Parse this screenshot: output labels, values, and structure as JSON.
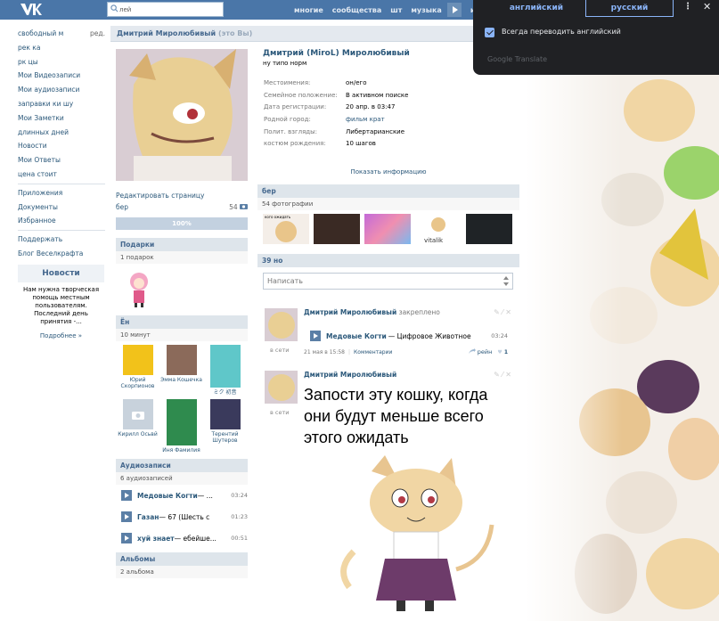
{
  "topbar": {
    "search_value": "лей",
    "nav": [
      "многие",
      "сообщества",
      "шт",
      "музыка",
      "и"
    ]
  },
  "leftmenu": {
    "edit_label": "ред.",
    "items": [
      "свободный м",
      "рек ка",
      "рк цы",
      "Мои Видеозаписи",
      "Мои аудиозаписи",
      "заправки ки шу",
      "Мои Заметки",
      "длинных дней",
      "Новости",
      "Мои Ответы",
      "цена стоит"
    ],
    "items2": [
      "Приложения",
      "Документы",
      "Избранное"
    ],
    "items3": [
      "Поддержать",
      "Блог Веселкрафта"
    ],
    "news_title": "Новости",
    "news_text": "Нам нужна творческая помощь местным пользователям. Последний день принятия -...",
    "news_more": "Подробнее »"
  },
  "profile": {
    "header_name": "Дмитрий Миролюбивый",
    "header_sub": "(это Вы)",
    "edit_page": "Редактировать страницу",
    "stat_label": "бер",
    "stat_num": "54",
    "progress_label": "100%",
    "progress_fraction": 1.0,
    "full_name": "Дмитрий (MiroL) Миролюбивый",
    "status": "ну типо норм",
    "info": [
      {
        "k": "Местоимения:",
        "v": "он/его",
        "link": false
      },
      {
        "k": "Семейное положение:",
        "v": "В активном поиске",
        "link": false
      },
      {
        "k": "Дата регистрации:",
        "v": "20 апр. в 03:47",
        "link": false
      },
      {
        "k": "Родной город:",
        "v": "фильм крат",
        "link": true
      },
      {
        "k": "Полит. взгляды:",
        "v": "Либертарианские",
        "link": false
      },
      {
        "k": "костюм рождения:",
        "v": "10 шагов",
        "link": false
      }
    ],
    "show_info": "Показать информацию"
  },
  "gifts": {
    "title": "Подарки",
    "count": "1 подарок"
  },
  "friends": {
    "title": "Ён",
    "sub": "10 минут",
    "list": [
      {
        "name": "Юрий Скорпионов",
        "color": "#f2c21a"
      },
      {
        "name": "Эмма Кошечка",
        "color": "#8b6a5a"
      },
      {
        "name": "ミク 初音",
        "color": "#5fc7c9"
      },
      {
        "name": "Кирилл Осьвй",
        "color": "#c8d2dc"
      },
      {
        "name": "Иня Фамилия",
        "color": "#2f8b4e"
      },
      {
        "name": "Терентий Шутеров",
        "color": "#3a3a5c"
      }
    ]
  },
  "audios": {
    "title": "Аудиозаписи",
    "count": "6 аудиозаписей",
    "list": [
      {
        "artist": "Медовые Когти",
        "title": " — ...",
        "dur": "03:24"
      },
      {
        "artist": "Газан",
        "title": " — 67 (Шесть с...",
        "dur": "01:23"
      },
      {
        "artist": "хуй знает",
        "title": " — ебейше...",
        "dur": "00:51"
      }
    ]
  },
  "albums": {
    "title": "Альбомы",
    "count": "2 альбома"
  },
  "photos": {
    "title": "бер",
    "count": "54 фотографии",
    "thumb1_text": "кого ожидать",
    "thumb4_text": "vitalik"
  },
  "wall": {
    "title": "39 но",
    "placeholder": "Написать"
  },
  "post1": {
    "author": "Дмитрий Миролюбивый",
    "pinned": " закреплено",
    "online": "в сети",
    "audio_artist": "Медовые Когти",
    "audio_title": "— Цифровое Животное",
    "audio_dur": "03:24",
    "date": "21 мая в 15:58",
    "comments": "Комментарии",
    "share": "рейн",
    "likes": "1"
  },
  "post2": {
    "author": "Дмитрий Миролюбивый",
    "online": "в сети",
    "text": "Запости эту кошку, когда они будут меньше всего этого ожидать"
  },
  "translate": {
    "lang_from": "английский",
    "lang_to": "русский",
    "always": "Всегда переводить английский",
    "brand": "Google Translate"
  },
  "colors": {
    "vk_blue": "#4a76a8",
    "link": "#2b587a",
    "translate_bg": "#202124",
    "translate_accent": "#8ab4f8"
  }
}
